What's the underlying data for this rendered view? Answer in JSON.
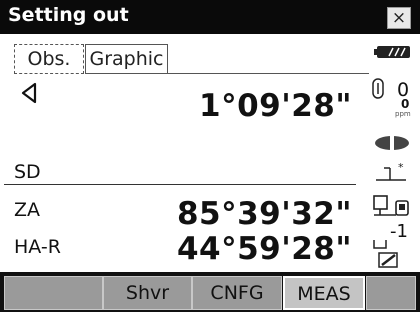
{
  "title": "Setting out",
  "close_label": "×",
  "tabs": [
    {
      "label": "Obs."
    },
    {
      "label": "Graphic"
    }
  ],
  "direction_value": "1°09'28\"",
  "rows": [
    {
      "label": "SD",
      "value": ""
    },
    {
      "label": "ZA",
      "value": "85°39'32\""
    },
    {
      "label": "HA-R",
      "value": "44°59'28\""
    }
  ],
  "status": {
    "ppm_value": "0",
    "ppm_sub": "0",
    "ppm_unit": "ppm",
    "target_constant": "-1",
    "icons": [
      "battery-icon",
      "ppm-icon",
      "laser-icon",
      "level-icon",
      "prism-icon",
      "target-constant-icon",
      "edit-icon"
    ]
  },
  "softkeys": [
    "",
    "Shvr",
    "CNFG",
    "MEAS"
  ],
  "colors": {
    "titlebar": "#0a0a0a",
    "softkey": "#9a9a9a",
    "softkey_active": "#c4c4c4"
  }
}
